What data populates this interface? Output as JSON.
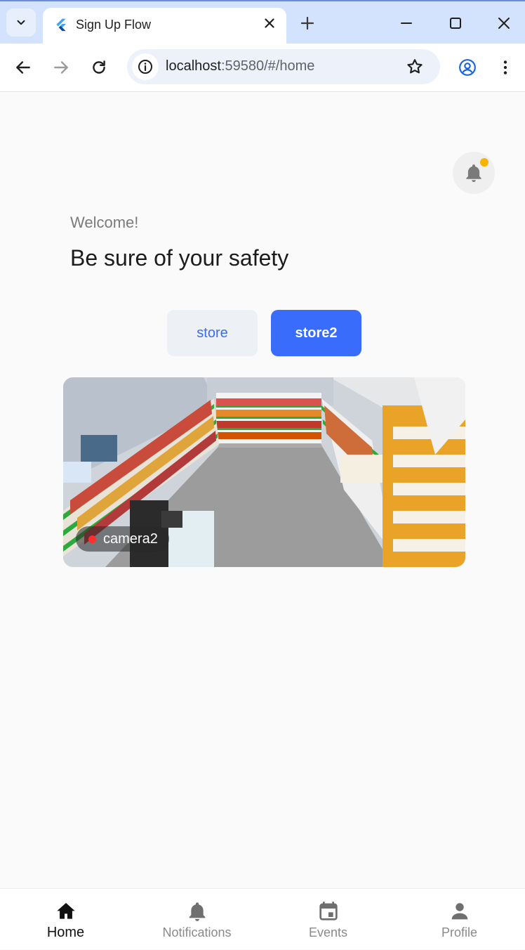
{
  "browser": {
    "tab_title": "Sign Up Flow",
    "url_host": "localhost",
    "url_rest": ":59580/#/home"
  },
  "app": {
    "welcome": "Welcome!",
    "headline": "Be sure of your safety",
    "notification_badge_color": "#f7b500",
    "stores": [
      {
        "label": "store",
        "selected": false
      },
      {
        "label": "store2",
        "selected": true
      }
    ],
    "accent_color": "#3a6cfc",
    "camera": {
      "name": "camera2",
      "status_color": "#ff2d2d"
    }
  },
  "bottom_nav": {
    "items": [
      {
        "label": "Home",
        "icon": "home-icon",
        "active": true
      },
      {
        "label": "Notifications",
        "icon": "bell-icon",
        "active": false
      },
      {
        "label": "Events",
        "icon": "calendar-icon",
        "active": false
      },
      {
        "label": "Profile",
        "icon": "person-icon",
        "active": false
      }
    ]
  }
}
